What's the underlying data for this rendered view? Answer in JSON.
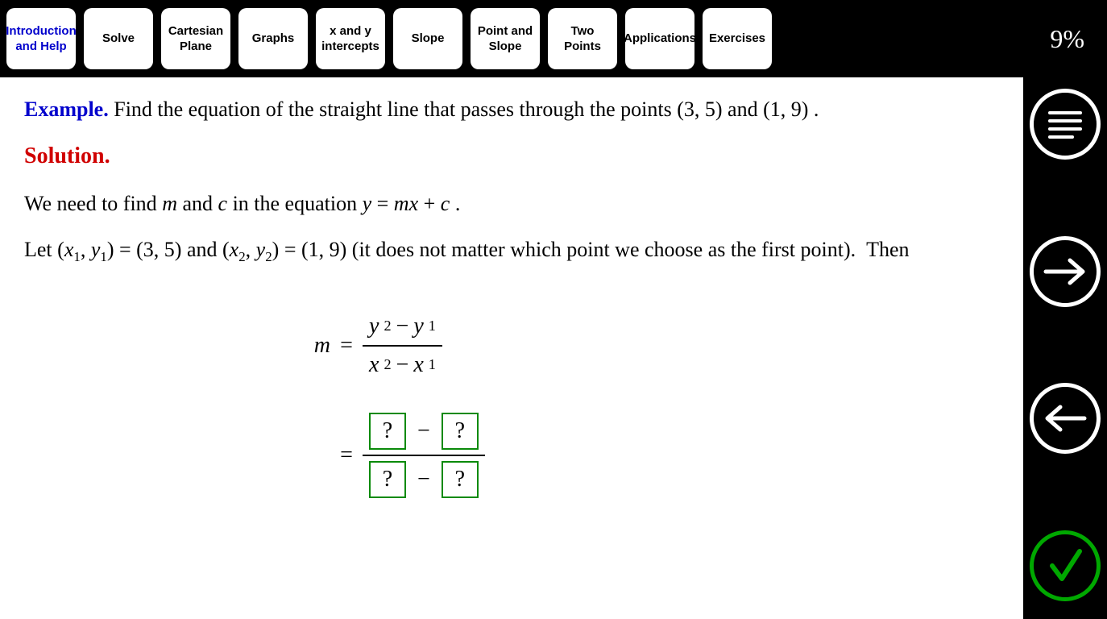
{
  "progress": "9%",
  "tabs": [
    {
      "label": "Introduction and Help",
      "active": true
    },
    {
      "label": "Solve",
      "active": false
    },
    {
      "label": "Cartesian Plane",
      "active": false
    },
    {
      "label": "Graphs",
      "active": false
    },
    {
      "label": "x and y intercepts",
      "active": false
    },
    {
      "label": "Slope",
      "active": false
    },
    {
      "label": "Point and Slope",
      "active": false
    },
    {
      "label": "Two Points",
      "active": false
    },
    {
      "label": "Applications",
      "active": false
    },
    {
      "label": "Exercises",
      "active": false
    }
  ],
  "content": {
    "example_label": "Example.",
    "example_text": "Find the equation of the straight line that passes through the points (3, 5) and (1, 9) .",
    "solution_label": "Solution.",
    "line1_a": "We need to find ",
    "line1_b": " and ",
    "line1_c": " in the equation ",
    "eq_y": "y",
    "eq_eq": " = ",
    "eq_mx": "mx",
    "eq_plus": " + ",
    "eq_c": "c",
    "line1_d": " .",
    "line2": "Let (x₁, y₁) = (3, 5) and (x₂, y₂) = (1, 9) (it does not matter which point we choose as the first point).  Then",
    "m_var": "m",
    "equals": "=",
    "frac1": {
      "num_a": "y",
      "num_asub": "2",
      "minus": "−",
      "num_b": "y",
      "num_bsub": "1",
      "den_a": "x",
      "den_asub": "2",
      "den_b": "x",
      "den_bsub": "1"
    },
    "q": "?"
  }
}
